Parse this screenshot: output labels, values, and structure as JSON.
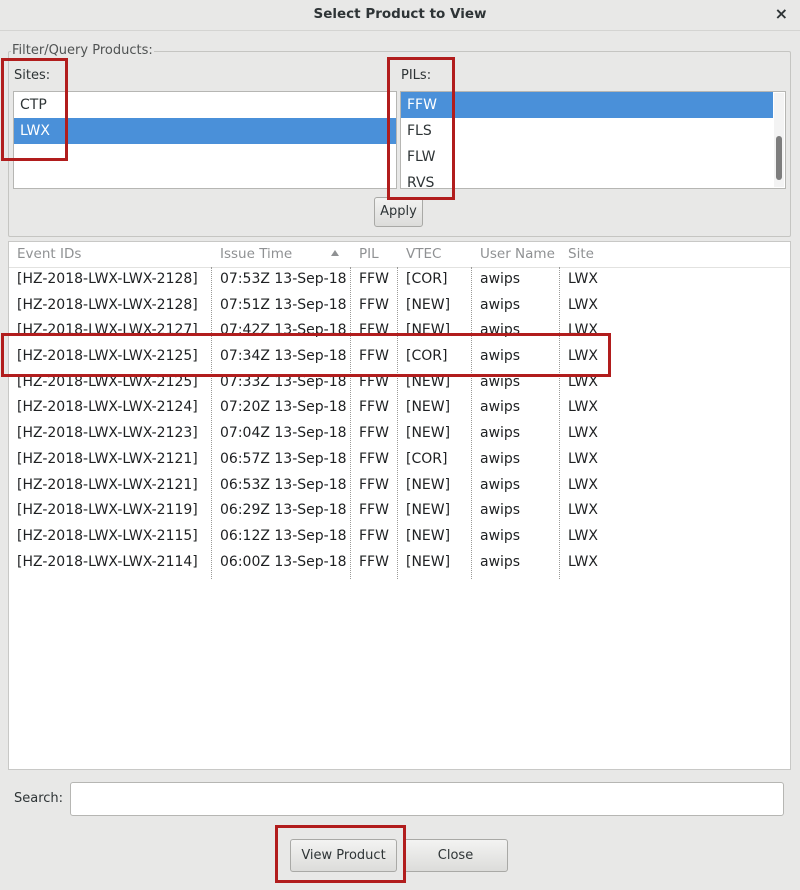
{
  "window": {
    "title": "Select Product to View",
    "close_glyph": "×"
  },
  "filter": {
    "legend": "Filter/Query Products:",
    "sites_label": "Sites:",
    "pils_label": "PILs:",
    "sites": [
      {
        "label": "CTP",
        "selected": false
      },
      {
        "label": "LWX",
        "selected": true
      }
    ],
    "pils": [
      {
        "label": "FFW",
        "selected": true
      },
      {
        "label": "FLS",
        "selected": false
      },
      {
        "label": "FLW",
        "selected": false
      },
      {
        "label": "RVS",
        "selected": false
      }
    ],
    "apply_label": "Apply"
  },
  "table": {
    "headers": [
      "Event IDs",
      "Issue Time",
      "PIL",
      "VTEC",
      "User Name",
      "Site"
    ],
    "sorted_column": "Issue Time",
    "rows": [
      [
        "[HZ-2018-LWX-LWX-2128]",
        "07:53Z 13-Sep-18",
        "FFW",
        "[COR]",
        "awips",
        "LWX"
      ],
      [
        "[HZ-2018-LWX-LWX-2128]",
        "07:51Z 13-Sep-18",
        "FFW",
        "[NEW]",
        "awips",
        "LWX"
      ],
      [
        "[HZ-2018-LWX-LWX-2127]",
        "07:42Z 13-Sep-18",
        "FFW",
        "[NEW]",
        "awips",
        "LWX"
      ],
      [
        "[HZ-2018-LWX-LWX-2125]",
        "07:34Z 13-Sep-18",
        "FFW",
        "[COR]",
        "awips",
        "LWX"
      ],
      [
        "[HZ-2018-LWX-LWX-2125]",
        "07:33Z 13-Sep-18",
        "FFW",
        "[NEW]",
        "awips",
        "LWX"
      ],
      [
        "[HZ-2018-LWX-LWX-2124]",
        "07:20Z 13-Sep-18",
        "FFW",
        "[NEW]",
        "awips",
        "LWX"
      ],
      [
        "[HZ-2018-LWX-LWX-2123]",
        "07:04Z 13-Sep-18",
        "FFW",
        "[NEW]",
        "awips",
        "LWX"
      ],
      [
        "[HZ-2018-LWX-LWX-2121]",
        "06:57Z 13-Sep-18",
        "FFW",
        "[COR]",
        "awips",
        "LWX"
      ],
      [
        "[HZ-2018-LWX-LWX-2121]",
        "06:53Z 13-Sep-18",
        "FFW",
        "[NEW]",
        "awips",
        "LWX"
      ],
      [
        "[HZ-2018-LWX-LWX-2119]",
        "06:29Z 13-Sep-18",
        "FFW",
        "[NEW]",
        "awips",
        "LWX"
      ],
      [
        "[HZ-2018-LWX-LWX-2115]",
        "06:12Z 13-Sep-18",
        "FFW",
        "[NEW]",
        "awips",
        "LWX"
      ],
      [
        "[HZ-2018-LWX-LWX-2114]",
        "06:00Z 13-Sep-18",
        "FFW",
        "[NEW]",
        "awips",
        "LWX"
      ]
    ]
  },
  "search": {
    "label": "Search:",
    "value": "",
    "placeholder": ""
  },
  "buttons": {
    "view_product": "View Product",
    "close": "Close"
  },
  "colors": {
    "selection": "#4a90d9",
    "annotation": "#b11d1d"
  }
}
